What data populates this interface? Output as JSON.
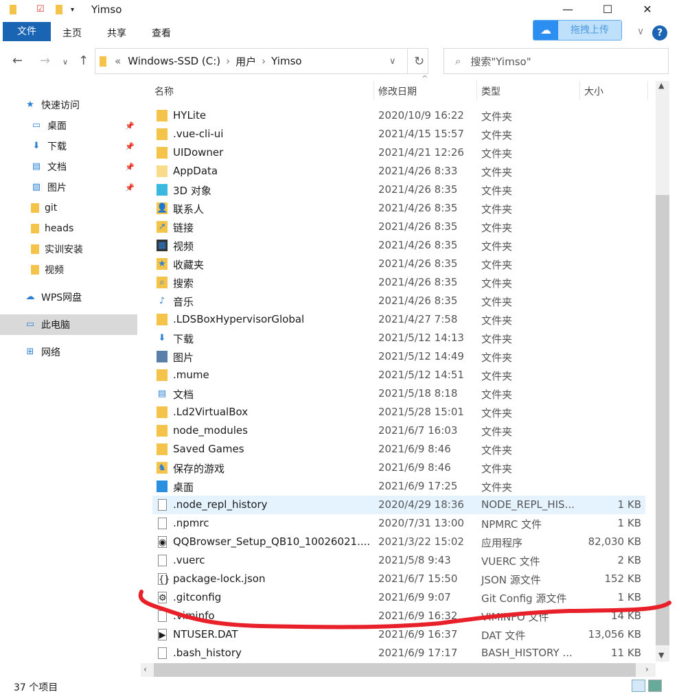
{
  "window": {
    "title": "Yimso",
    "minimize": "—",
    "maximize": "☐",
    "close": "✕"
  },
  "ribbon": {
    "tabs": [
      "文件",
      "主页",
      "共享",
      "查看"
    ],
    "upload_label": "拖拽上传",
    "help": "?",
    "expand": "∨"
  },
  "nav": {
    "back": "←",
    "forward": "→",
    "recent": "∨",
    "up": "↑",
    "refresh": "↻"
  },
  "address": {
    "prefix": "«",
    "path": [
      "Windows-SSD (C:)",
      "用户",
      "Yimso"
    ],
    "sep": "›",
    "dropdown": "∨"
  },
  "search": {
    "placeholder": "搜索\"Yimso\""
  },
  "sidebar": {
    "items": [
      {
        "label": "快速访问",
        "icon": "star-icon",
        "pinned": false
      },
      {
        "label": "桌面",
        "icon": "desktop-icon",
        "pinned": true
      },
      {
        "label": "下载",
        "icon": "download-icon",
        "pinned": true
      },
      {
        "label": "文档",
        "icon": "document-icon",
        "pinned": true
      },
      {
        "label": "图片",
        "icon": "pictures-icon",
        "pinned": true
      },
      {
        "label": "git",
        "icon": "folder-icon",
        "pinned": false
      },
      {
        "label": "heads",
        "icon": "folder-icon",
        "pinned": false
      },
      {
        "label": "实训安装",
        "icon": "folder-icon",
        "pinned": false
      },
      {
        "label": "视频",
        "icon": "folder-icon",
        "pinned": false
      },
      {
        "label": "WPS网盘",
        "icon": "cloud-icon",
        "pinned": false
      },
      {
        "label": "此电脑",
        "icon": "computer-icon",
        "pinned": false,
        "selected": true
      },
      {
        "label": "网络",
        "icon": "network-icon",
        "pinned": false
      }
    ]
  },
  "columns": {
    "name": "名称",
    "date": "修改日期",
    "type": "类型",
    "size": "大小"
  },
  "files": [
    {
      "name": "HYLite",
      "date": "2020/10/9 16:22",
      "type": "文件夹",
      "size": "",
      "icon": "folder"
    },
    {
      "name": ".vue-cli-ui",
      "date": "2021/4/15 15:57",
      "type": "文件夹",
      "size": "",
      "icon": "folder"
    },
    {
      "name": "UIDowner",
      "date": "2021/4/21 12:26",
      "type": "文件夹",
      "size": "",
      "icon": "folder"
    },
    {
      "name": "AppData",
      "date": "2021/4/26 8:33",
      "type": "文件夹",
      "size": "",
      "icon": "folder-hidden"
    },
    {
      "name": "3D 对象",
      "date": "2021/4/26 8:35",
      "type": "文件夹",
      "size": "",
      "icon": "3d"
    },
    {
      "name": "联系人",
      "date": "2021/4/26 8:35",
      "type": "文件夹",
      "size": "",
      "icon": "contacts"
    },
    {
      "name": "链接",
      "date": "2021/4/26 8:35",
      "type": "文件夹",
      "size": "",
      "icon": "links"
    },
    {
      "name": "视频",
      "date": "2021/4/26 8:35",
      "type": "文件夹",
      "size": "",
      "icon": "video"
    },
    {
      "name": "收藏夹",
      "date": "2021/4/26 8:35",
      "type": "文件夹",
      "size": "",
      "icon": "favorites"
    },
    {
      "name": "搜索",
      "date": "2021/4/26 8:35",
      "type": "文件夹",
      "size": "",
      "icon": "search"
    },
    {
      "name": "音乐",
      "date": "2021/4/26 8:35",
      "type": "文件夹",
      "size": "",
      "icon": "music"
    },
    {
      "name": ".LDSBoxHypervisorGlobal",
      "date": "2021/4/27 7:58",
      "type": "文件夹",
      "size": "",
      "icon": "folder"
    },
    {
      "name": "下载",
      "date": "2021/5/12 14:13",
      "type": "文件夹",
      "size": "",
      "icon": "download"
    },
    {
      "name": "图片",
      "date": "2021/5/12 14:49",
      "type": "文件夹",
      "size": "",
      "icon": "pictures"
    },
    {
      "name": ".mume",
      "date": "2021/5/12 14:51",
      "type": "文件夹",
      "size": "",
      "icon": "folder"
    },
    {
      "name": "文档",
      "date": "2021/5/18 8:18",
      "type": "文件夹",
      "size": "",
      "icon": "document"
    },
    {
      "name": ".Ld2VirtualBox",
      "date": "2021/5/28 15:01",
      "type": "文件夹",
      "size": "",
      "icon": "folder"
    },
    {
      "name": "node_modules",
      "date": "2021/6/7 16:03",
      "type": "文件夹",
      "size": "",
      "icon": "folder"
    },
    {
      "name": "Saved Games",
      "date": "2021/6/9 8:46",
      "type": "文件夹",
      "size": "",
      "icon": "folder"
    },
    {
      "name": "保存的游戏",
      "date": "2021/6/9 8:46",
      "type": "文件夹",
      "size": "",
      "icon": "games"
    },
    {
      "name": "桌面",
      "date": "2021/6/9 17:25",
      "type": "文件夹",
      "size": "",
      "icon": "desktop"
    },
    {
      "name": ".node_repl_history",
      "date": "2020/4/29 18:36",
      "type": "NODE_REPL_HIS...",
      "size": "1 KB",
      "icon": "file",
      "highlight": true
    },
    {
      "name": ".npmrc",
      "date": "2020/7/31 13:00",
      "type": "NPMRC 文件",
      "size": "1 KB",
      "icon": "file"
    },
    {
      "name": "QQBrowser_Setup_QB10_10026021....",
      "date": "2021/3/22 15:02",
      "type": "应用程序",
      "size": "82,030 KB",
      "icon": "exe"
    },
    {
      "name": ".vuerc",
      "date": "2021/5/8 9:43",
      "type": "VUERC 文件",
      "size": "2 KB",
      "icon": "file"
    },
    {
      "name": "package-lock.json",
      "date": "2021/6/7 15:50",
      "type": "JSON 源文件",
      "size": "152 KB",
      "icon": "json"
    },
    {
      "name": ".gitconfig",
      "date": "2021/6/9 9:07",
      "type": "Git Config 源文件",
      "size": "1 KB",
      "icon": "config"
    },
    {
      "name": ".viminfo",
      "date": "2021/6/9 16:32",
      "type": "VIMINFO 文件",
      "size": "14 KB",
      "icon": "file"
    },
    {
      "name": "NTUSER.DAT",
      "date": "2021/6/9 16:37",
      "type": "DAT 文件",
      "size": "13,056 KB",
      "icon": "dat"
    },
    {
      "name": ".bash_history",
      "date": "2021/6/9 17:17",
      "type": "BASH_HISTORY ...",
      "size": "11 KB",
      "icon": "file"
    }
  ],
  "status": {
    "count": "37 个项目"
  },
  "colors": {
    "accent": "#1a64b4",
    "annotation": "#e8202a",
    "selection": "#e5f3ff"
  }
}
